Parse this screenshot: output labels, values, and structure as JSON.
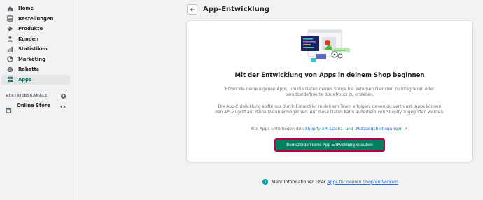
{
  "sidebar": {
    "items": [
      {
        "label": "Home",
        "icon": "home-icon"
      },
      {
        "label": "Bestellungen",
        "icon": "orders-icon"
      },
      {
        "label": "Produkte",
        "icon": "tag-icon"
      },
      {
        "label": "Kunden",
        "icon": "customer-icon"
      },
      {
        "label": "Statistiken",
        "icon": "analytics-icon"
      },
      {
        "label": "Marketing",
        "icon": "marketing-icon"
      },
      {
        "label": "Rabatte",
        "icon": "discount-icon"
      },
      {
        "label": "Apps",
        "icon": "apps-icon",
        "active": true
      }
    ],
    "sales_channels_label": "VERTRIEBSKANÄLE",
    "online_store_label": "Online Store"
  },
  "header": {
    "title": "App-Entwicklung"
  },
  "card": {
    "title": "Mit der Entwicklung von Apps in deinem Shop beginnen",
    "paragraph1": "Entwickle deine eigenen Apps, um die Daten deines Shops bei externen Diensten zu integrieren oder benutzerdefinierte Storefronts zu erstellen.",
    "paragraph2": "Die App-Entwicklung sollte nur durch Entwickler in deinem Team erfolgen, denen du vertraust. Apps können den API-Zugriff auf deine Daten ermöglichen. Auf diese Daten kann außerhalb von Shopify zugegriffen werden.",
    "terms_prefix": "Alle Apps unterliegen den",
    "terms_link": "Shopify-API-Lizenz- und -Nutzungsbedingungen",
    "terms_suffix": ".",
    "cta_label": "Benutzerdefinierte App-Entwicklung erlauben"
  },
  "footer": {
    "text": "Mehr Informationen über",
    "link": "Apps für deinen Shop entwickeln"
  },
  "colors": {
    "accent": "#008060",
    "active_nav": "#007f5f",
    "link": "#2c6ecb",
    "info": "#00a0ac",
    "focus_outline": "#b5004a"
  }
}
